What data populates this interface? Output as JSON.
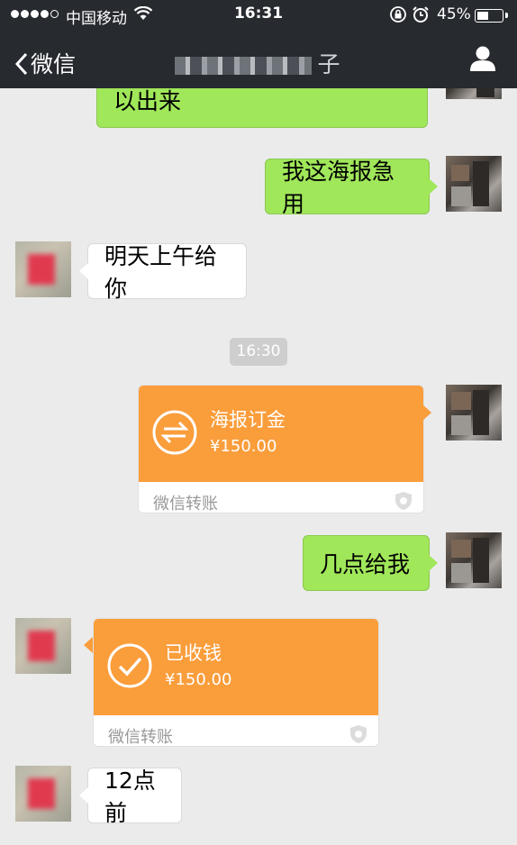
{
  "status_bar": {
    "carrier": "中国移动",
    "time": "16:31",
    "battery_percent": "45%",
    "battery_level": 0.45
  },
  "nav": {
    "back_label": "微信",
    "chat_title_visible_char": "子",
    "profile_icon": "person-icon"
  },
  "messages": [
    {
      "side": "right",
      "type": "text",
      "text": "以出来"
    },
    {
      "side": "right",
      "type": "text",
      "text": "我这海报急用"
    },
    {
      "side": "left",
      "type": "text",
      "text": "明天上午给你"
    },
    {
      "type": "timestamp",
      "text": "16:30"
    },
    {
      "side": "right",
      "type": "transfer",
      "title": "海报订金",
      "amount": "¥150.00",
      "label": "微信转账",
      "icon": "transfer-arrows-icon"
    },
    {
      "side": "right",
      "type": "text",
      "text": "几点给我"
    },
    {
      "side": "left",
      "type": "transfer",
      "title": "已收钱",
      "amount": "¥150.00",
      "label": "微信转账",
      "icon": "check-circle-icon"
    },
    {
      "side": "left",
      "type": "text",
      "text": "12点前"
    }
  ],
  "colors": {
    "nav_bg": "#272a2f",
    "chat_bg": "#ebebeb",
    "sent_bubble": "#a0e75a",
    "received_bubble": "#ffffff",
    "transfer_card": "#fa9d3b"
  }
}
